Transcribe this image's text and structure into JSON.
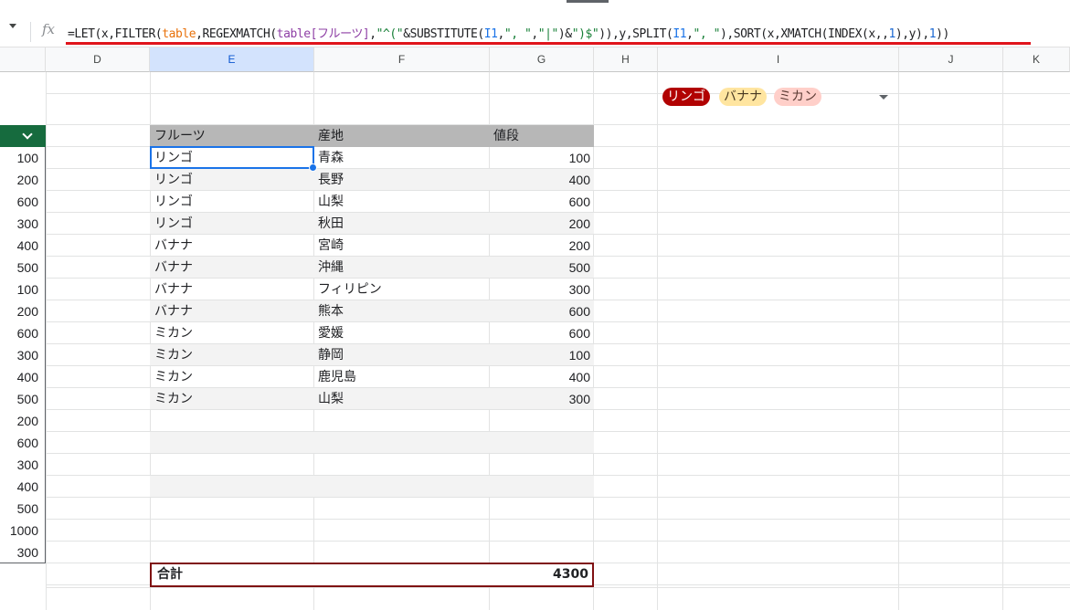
{
  "formula_bar": {
    "fx_label": "fx",
    "formula_parts": [
      {
        "text": "=LET(x,FILTER(",
        "type": "plain"
      },
      {
        "text": "table",
        "type": "table"
      },
      {
        "text": ",REGEXMATCH(",
        "type": "plain"
      },
      {
        "text": "table[フルーツ]",
        "type": "tablepurple"
      },
      {
        "text": ",",
        "type": "plain"
      },
      {
        "text": "\"^(\"",
        "type": "str"
      },
      {
        "text": "&SUBSTITUTE(",
        "type": "plain"
      },
      {
        "text": "I1",
        "type": "ref"
      },
      {
        "text": ",",
        "type": "plain"
      },
      {
        "text": "\", \"",
        "type": "str"
      },
      {
        "text": ",",
        "type": "plain"
      },
      {
        "text": "\"|\"",
        "type": "str"
      },
      {
        "text": ")&",
        "type": "plain"
      },
      {
        "text": "\")$\"",
        "type": "str"
      },
      {
        "text": ")),y,SPLIT(",
        "type": "plain"
      },
      {
        "text": "I1",
        "type": "ref"
      },
      {
        "text": ",",
        "type": "plain"
      },
      {
        "text": "\", \"",
        "type": "str"
      },
      {
        "text": "),SORT(x,XMATCH(INDEX(x,,",
        "type": "plain"
      },
      {
        "text": "1",
        "type": "num"
      },
      {
        "text": "),y),",
        "type": "plain"
      },
      {
        "text": "1",
        "type": "num"
      },
      {
        "text": "))",
        "type": "plain"
      }
    ]
  },
  "columns": [
    "D",
    "E",
    "F",
    "G",
    "H",
    "I",
    "J",
    "K"
  ],
  "left_column_values": [
    "100",
    "200",
    "600",
    "300",
    "400",
    "500",
    "100",
    "200",
    "600",
    "300",
    "400",
    "500",
    "200",
    "600",
    "300",
    "400",
    "500",
    "1000",
    "300"
  ],
  "table": {
    "headers": [
      "フルーツ",
      "産地",
      "値段"
    ],
    "rows": [
      [
        "リンゴ",
        "青森",
        "100"
      ],
      [
        "リンゴ",
        "長野",
        "400"
      ],
      [
        "リンゴ",
        "山梨",
        "600"
      ],
      [
        "リンゴ",
        "秋田",
        "200"
      ],
      [
        "バナナ",
        "宮崎",
        "200"
      ],
      [
        "バナナ",
        "沖縄",
        "500"
      ],
      [
        "バナナ",
        "フィリピン",
        "300"
      ],
      [
        "バナナ",
        "熊本",
        "600"
      ],
      [
        "ミカン",
        "愛媛",
        "600"
      ],
      [
        "ミカン",
        "静岡",
        "100"
      ],
      [
        "ミカン",
        "鹿児島",
        "400"
      ],
      [
        "ミカン",
        "山梨",
        "300"
      ]
    ],
    "empty_rows": 5
  },
  "total": {
    "label": "合計",
    "value": "4300"
  },
  "chips": [
    {
      "label": "リンゴ",
      "color": "#b10202"
    },
    {
      "label": "バナナ",
      "color": "#ffe5a0"
    },
    {
      "label": "ミカン",
      "color": "#ffcfc9"
    }
  ],
  "colors": {
    "accent": "#1a73e8",
    "highlight": "#e0141c",
    "total_border": "#7f1012"
  }
}
